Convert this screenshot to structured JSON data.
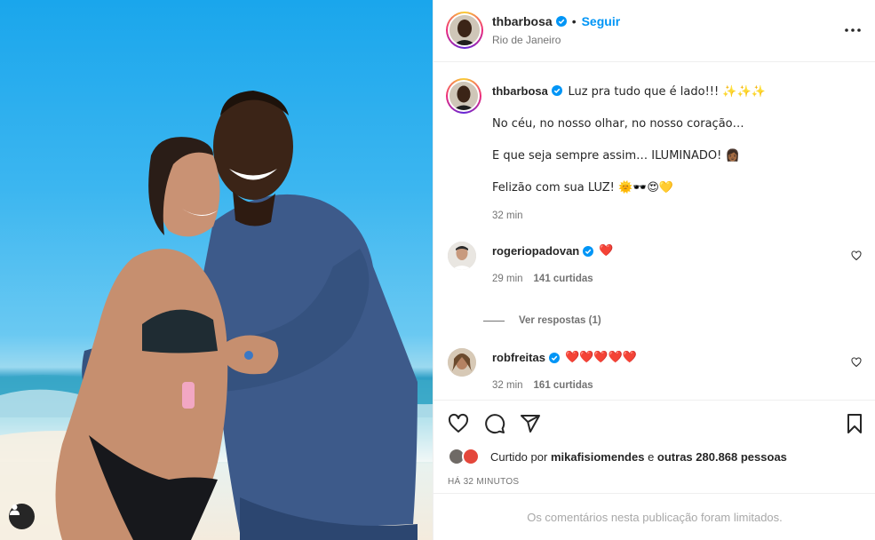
{
  "post": {
    "username": "thbarbosa",
    "follow_label": "Seguir",
    "location": "Rio de Janeiro",
    "separator": "•",
    "more_icon": "more-options-icon"
  },
  "caption": {
    "username": "thbarbosa",
    "line1": "Luz pra tudo que é lado!!! ✨✨✨",
    "line2": "No céu, no nosso olhar, no nosso coração…",
    "line3": "E que seja sempre assim… ILUMINADO! 👩🏾",
    "line4": "Felizão com sua LUZ! 🌞🕶️😍💛",
    "time": "32 min"
  },
  "comments": [
    {
      "username": "rogeriopadovan",
      "text": "❤️",
      "time": "29 min",
      "likes": "141 curtidas",
      "replies_label": "Ver respostas (1)"
    },
    {
      "username": "robfreitas",
      "text": "❤️❤️❤️❤️❤️",
      "time": "32 min",
      "likes": "161 curtidas"
    }
  ],
  "liked_by": {
    "prefix": "Curtido por",
    "user": "mikafisiomendes",
    "middle": "e",
    "others": "outras 280.868 pessoas"
  },
  "time_ago": "HÁ 32 MINUTOS",
  "footer": "Os comentários nesta publicação foram limitados.",
  "colors": {
    "accent": "#0095f6",
    "text": "#262626",
    "muted": "#737373",
    "heart_red": "#ed4956"
  }
}
